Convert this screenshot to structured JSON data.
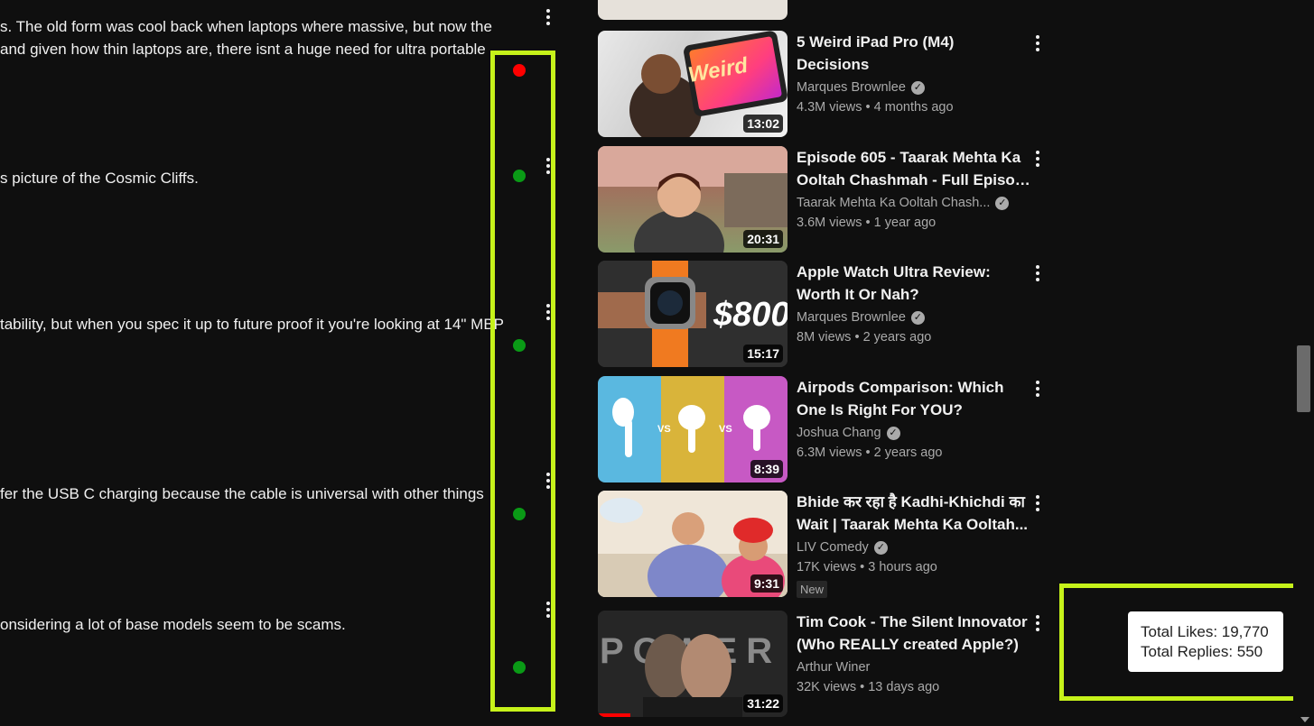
{
  "comments": [
    {
      "lines": [
        "s. The old form was cool back when laptops where massive, but now the",
        "and given how thin laptops are, there isnt a huge need for ultra portable"
      ]
    },
    {
      "lines": [
        "s picture of the Cosmic Cliffs."
      ]
    },
    {
      "lines": [
        "tability, but when you spec it up to future proof it you're looking at 14\" MBP"
      ]
    },
    {
      "lines": [
        "fer the USB C charging because the cable is universal with other things"
      ]
    },
    {
      "lines": [
        "onsidering a lot of base models seem to be scams."
      ]
    }
  ],
  "sentiment": [
    "negative",
    "positive",
    "positive",
    "positive",
    "positive"
  ],
  "colors": {
    "highlight": "#c6f21a",
    "negative": "#ff0000",
    "positive": "#0a9a16"
  },
  "videos": [
    {
      "title1": "5 Weird iPad Pro (M4)",
      "title2": "Decisions",
      "channel": "Marques Brownlee",
      "verified": true,
      "views": "4.3M views",
      "age": "4 months ago",
      "duration": "13:02",
      "thumb_text": "Weird"
    },
    {
      "title1": "Episode 605 - Taarak Mehta Ka",
      "title2": "Ooltah Chashmah - Full Episod...",
      "channel": "Taarak Mehta Ka Ooltah Chash...",
      "verified": true,
      "views": "3.6M views",
      "age": "1 year ago",
      "duration": "20:31",
      "thumb_text": ""
    },
    {
      "title1": "Apple Watch Ultra Review:",
      "title2": "Worth It Or Nah?",
      "channel": "Marques Brownlee",
      "verified": true,
      "views": "8M views",
      "age": "2 years ago",
      "duration": "15:17",
      "thumb_text": "$800"
    },
    {
      "title1": "Airpods Comparison: Which",
      "title2": "One Is Right For YOU?",
      "channel": "Joshua Chang",
      "verified": true,
      "views": "6.3M views",
      "age": "2 years ago",
      "duration": "8:39",
      "thumb_text": "VS"
    },
    {
      "title1": "Bhide कर रहा है Kadhi-Khichdi का",
      "title2": "Wait | Taarak Mehta Ka Ooltah...",
      "channel": "LIV Comedy",
      "verified": true,
      "views": "17K views",
      "age": "3 hours ago",
      "duration": "9:31",
      "badge": "New",
      "thumb_text": ""
    },
    {
      "title1": "Tim Cook - The Silent Innovator",
      "title2": "(Who REALLY created Apple?)",
      "channel": "Arthur Winer",
      "verified": false,
      "views": "32K views",
      "age": "13 days ago",
      "duration": "31:22",
      "thumb_text": "POWER",
      "progress": 0.17
    }
  ],
  "stats": {
    "likes": "Total Likes: 19,770",
    "replies": "Total Replies: 550"
  }
}
